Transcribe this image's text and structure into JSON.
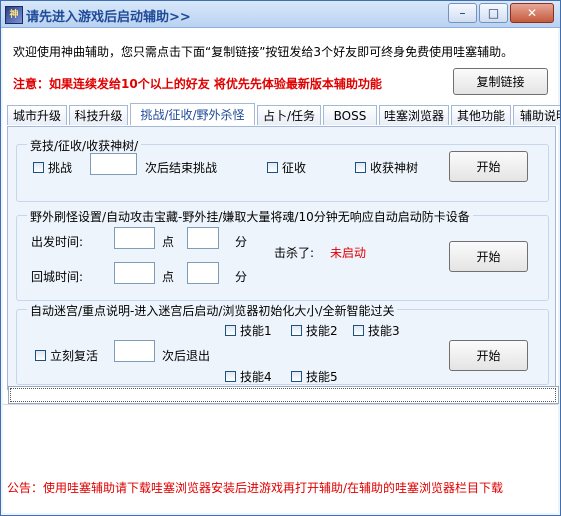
{
  "window": {
    "title": "请先进入游戏后启动辅助>>",
    "icon": "app-logo-icon",
    "controls": {
      "minimize": "–",
      "maximize": "□",
      "close": "✕"
    }
  },
  "header": {
    "welcome": "欢迎使用神曲辅助，您只需点击下面“复制链接”按钮发给3个好友即可终身免费使用哇塞辅助。",
    "notice": "注意：如果连续发给10个以上的好友 将优先先体验最新版本辅助功能",
    "copy_button": "复制链接"
  },
  "tabs": [
    {
      "label": "城市升级",
      "width": 58
    },
    {
      "label": "科技升级",
      "width": 57
    },
    {
      "label": "挑战/征收/野外杀怪",
      "width": 123,
      "active": true
    },
    {
      "label": "占卜/任务",
      "width": 62
    },
    {
      "label": "BOSS",
      "width": 52
    },
    {
      "label": "哇塞浏览器",
      "width": 68
    },
    {
      "label": "其他功能",
      "width": 58
    },
    {
      "label": "辅助说明",
      "width": 60
    }
  ],
  "group1": {
    "title": "竞技/征收/收获神树/",
    "challenge_label": "挑战",
    "challenge_suffix": "次后结束挑战",
    "challenge_count": "",
    "collect_label": "征收",
    "harvest_label": "收获神树",
    "start_button": "开始"
  },
  "group2": {
    "title": "野外刷怪设置/自动攻击宝藏-野外挂/嫌取大量将魂/10分钟无响应自动启动防卡设备",
    "depart_label": "出发时间:",
    "return_label": "回城时间:",
    "hour_unit": "点",
    "minute_unit": "分",
    "depart_hour": "",
    "depart_minute": "",
    "return_hour": "",
    "return_minute": "",
    "kills_label": "击杀了:",
    "status": "未启动",
    "start_button": "开始"
  },
  "group3": {
    "title": "自动迷宫/重点说明-进入迷宫后启动/浏览器初始化大小/全新智能过关",
    "revive_label": "立刻复活",
    "exit_suffix": "次后退出",
    "exit_count": "",
    "skills": [
      "技能1",
      "技能2",
      "技能3",
      "技能4",
      "技能5"
    ],
    "start_button": "开始"
  },
  "footer": {
    "announcement": "公告：使用哇塞辅助请下载哇塞浏览器安装后进游戏再打开辅助/在辅助的哇塞浏览器栏目下载"
  }
}
